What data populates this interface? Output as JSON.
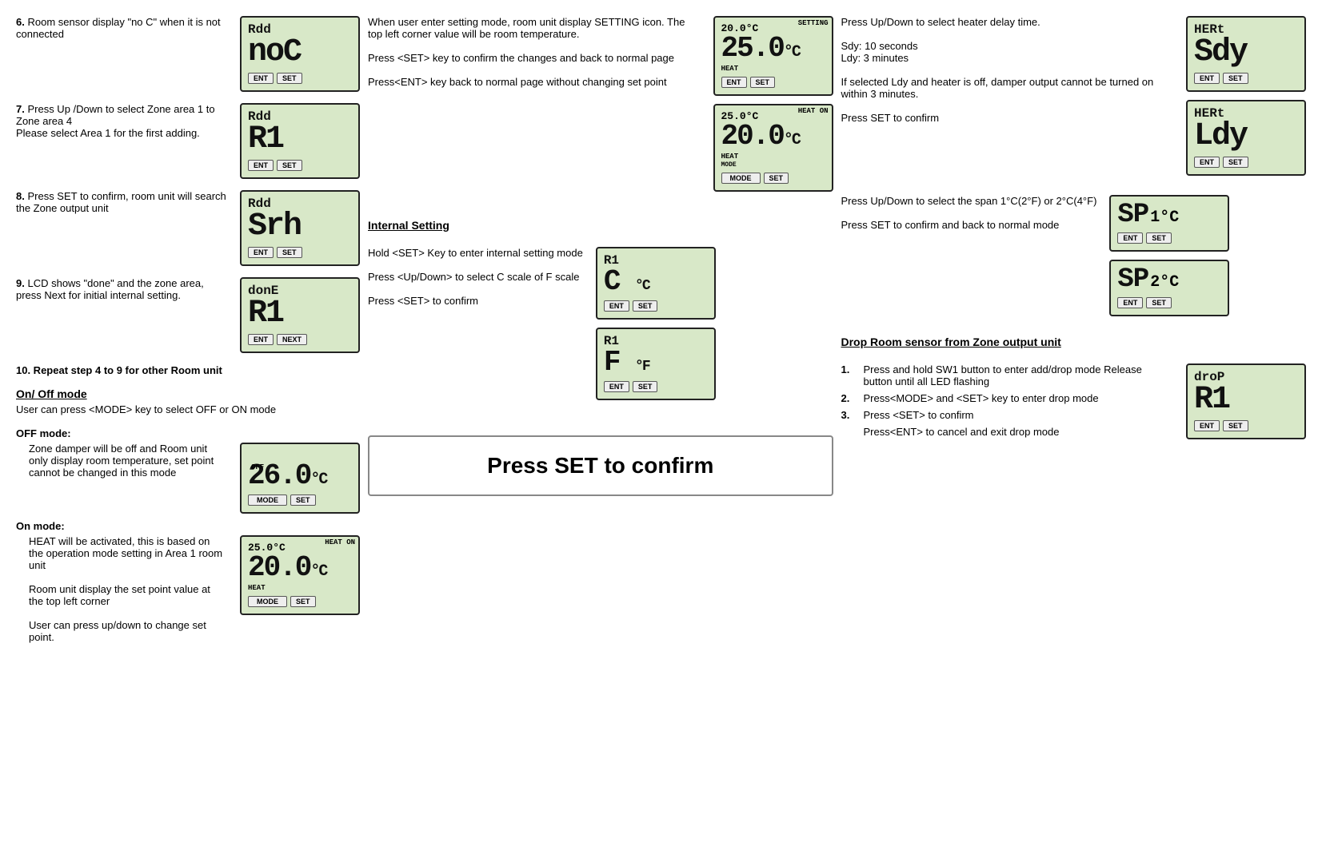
{
  "col1": {
    "items": [
      {
        "num": "6.",
        "text": "Room sensor display \"no C\" when it is not connected",
        "lcd": {
          "line1": "Rdd",
          "line2": "noC",
          "buttons": [
            "ENT",
            "SET"
          ]
        }
      },
      {
        "num": "7.",
        "text": "Press Up /Down to select Zone area 1 to Zone area 4\nPlease select Area 1 for the first adding.",
        "lcd": {
          "line1": "Rdd",
          "line2": "R1",
          "buttons": [
            "ENT",
            "SET"
          ]
        }
      },
      {
        "num": "8.",
        "text": "Press SET to confirm, room unit will search the Zone output unit",
        "lcd": {
          "line1": "Rdd",
          "line2": "Srh",
          "buttons": [
            "ENT",
            "SET"
          ]
        }
      },
      {
        "num": "9.",
        "text": "LCD shows \"done\" and the zone area, press Next for initial internal setting.",
        "lcd": {
          "line1": "donE",
          "line2": "R1",
          "buttons": [
            "ENT",
            "NEXT"
          ]
        }
      }
    ],
    "repeat_text": "10.   Repeat step 4 to 9 for other Room unit",
    "onoff": {
      "title": "On/ Off mode",
      "desc1": "User can press <MODE> key to select OFF or ON mode",
      "off_mode_title": "OFF mode:",
      "off_mode_desc": "Zone damper will be off and Room unit only display room temperature, set point cannot be changed in this mode",
      "lcd_off": {
        "value": "26.0°C",
        "label_left": "OFF",
        "label_bottom": "MODE",
        "buttons": [
          "MODE",
          "SET"
        ],
        "badge": ""
      },
      "on_mode_title": "On mode:",
      "on_mode_desc1": "HEAT will be activated, this is based on the operation mode setting in Area 1 room unit",
      "on_mode_desc2": "Room unit display the set point value at the top left corner",
      "on_mode_desc3": "User can press up/down to change set point.",
      "lcd_on": {
        "top": "25.0°C",
        "badge": "HEAT ON",
        "main": "20.0°C",
        "label_bottom": "HEAT",
        "label_left": "",
        "buttons": [
          "MODE",
          "SET"
        ]
      }
    }
  },
  "col2": {
    "setting_intro": {
      "text": "When user enter setting mode, room unit display SETTING icon. The top left corner value will be room temperature.",
      "confirm": "Press <SET> key to confirm the changes and back to normal page",
      "back": "Press<ENT> key back to normal page without changing set point",
      "lcd1": {
        "top": "20.0°C",
        "badge": "SETTING",
        "main": "25.0°C",
        "label_bottom": "HEAT",
        "buttons": [
          "ENT",
          "SET"
        ]
      },
      "lcd2": {
        "top": "25.0°C",
        "badge": "HEAT ON",
        "main": "20.0°C",
        "label_bottom": "HEAT",
        "label_mode": "MODE",
        "buttons": [
          "MODE",
          "SET"
        ]
      }
    },
    "internal": {
      "title": "Internal Setting",
      "hold_text": "Hold <SET> Key to enter internal setting mode",
      "updown_text": "Press <Up/Down> to select C scale of F scale",
      "confirm": "Press <SET> to confirm",
      "lcd_c": {
        "line1": "R1",
        "line2": "C °C",
        "buttons": [
          "ENT",
          "SET"
        ]
      },
      "lcd_f": {
        "line1": "R1",
        "line2": "F °F",
        "buttons": [
          "ENT",
          "SET"
        ]
      }
    },
    "press_set": {
      "title": "Press SET to confirm"
    }
  },
  "col3": {
    "heater_delay": {
      "text1": "Press Up/Down to select heater delay time.",
      "sdy": "Sdy: 10 seconds",
      "ldy": "Ldy: 3 minutes",
      "text2": "If selected Ldy and heater is off, damper output cannot be turned on within 3 minutes.",
      "text3": "Press SET to confirm",
      "lcd_sdy": {
        "line1": "HERt",
        "line2": "Sdy",
        "buttons": [
          "ENT",
          "SET"
        ]
      },
      "lcd_ldy": {
        "line1": "HERt",
        "line2": "Ldy",
        "buttons": [
          "ENT",
          "SET"
        ]
      }
    },
    "span": {
      "text1": "Press Up/Down to select the span 1°C(2°F) or 2°C(4°F)",
      "text2": "Press SET to confirm and back to normal mode",
      "lcd_sp1": {
        "line1": "SP",
        "line2": "1°C",
        "buttons": [
          "ENT",
          "SET"
        ]
      },
      "lcd_sp2": {
        "line1": "SP",
        "line2": "2°C",
        "buttons": [
          "ENT",
          "SET"
        ]
      }
    },
    "drop": {
      "title": "Drop Room sensor from Zone output unit",
      "step1": "Press and hold SW1 button to enter add/drop mode Release button until all LED flashing",
      "step2": "Press<MODE> and <SET> key to enter drop mode",
      "step3": "Press <SET> to confirm",
      "step3b": "Press<ENT> to cancel and exit drop mode",
      "lcd": {
        "line1": "droP",
        "line2": "R1",
        "buttons": [
          "ENT",
          "SET"
        ]
      }
    }
  }
}
